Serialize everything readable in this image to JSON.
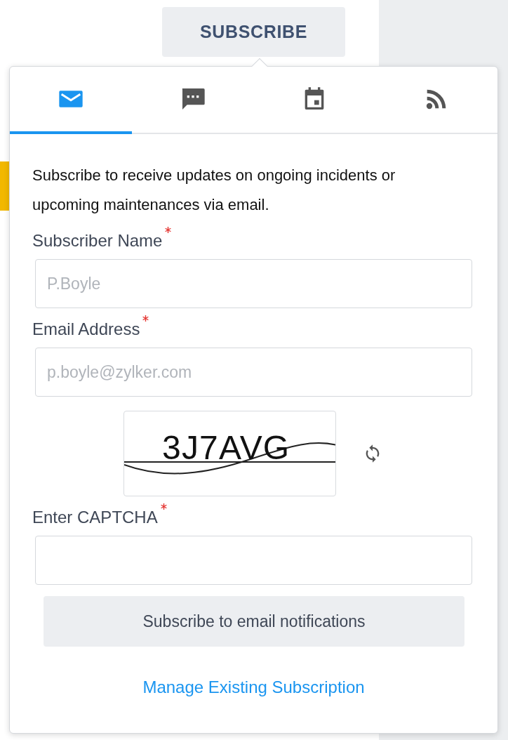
{
  "subscribe_button": {
    "label": "SUBSCRIBE"
  },
  "tabs": [
    {
      "kind": "email",
      "selected": true
    },
    {
      "kind": "sms",
      "selected": false
    },
    {
      "kind": "calendar",
      "selected": false
    },
    {
      "kind": "rss",
      "selected": false
    }
  ],
  "description": "Subscribe to receive updates on ongoing incidents or upcoming maintenances via email.",
  "fields": [
    {
      "label": "Subscriber Name",
      "required": true,
      "placeholder": "P.Boyle"
    },
    {
      "label": "Email Address",
      "required": true,
      "placeholder": "p.boyle@zylker.com"
    }
  ],
  "captcha": {
    "text": "3J7AVG"
  },
  "captcha_field": {
    "label": "Enter CAPTCHA",
    "required": true
  },
  "submit_button": {
    "label": "Subscribe to email notifications"
  },
  "manage_link": {
    "label": "Manage Existing Subscription"
  }
}
